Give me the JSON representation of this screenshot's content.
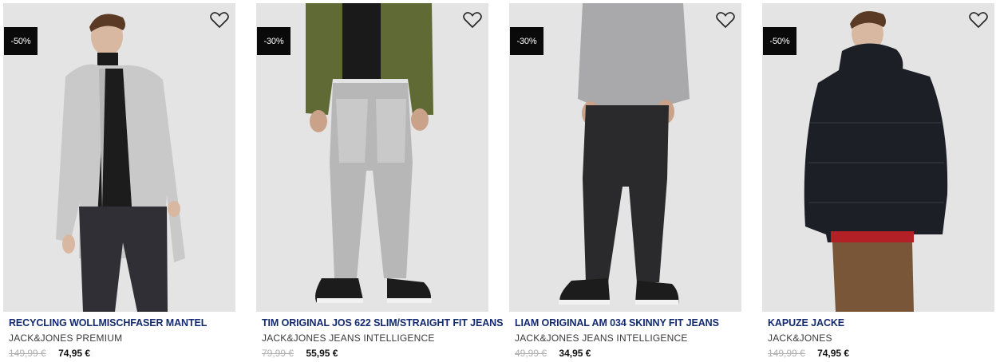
{
  "products": [
    {
      "badge": "-50%",
      "title": "RECYCLING WOLLMISCHFASER MANTEL",
      "brand": "JACK&JONES PREMIUM",
      "old_price": "149,99 €",
      "new_price": "74,95 €",
      "image_desc": "man in grey wool coat"
    },
    {
      "badge": "-30%",
      "title": "TIM ORIGINAL JOS 622 SLIM/STRAIGHT FIT JEANS",
      "brand": "JACK&JONES JEANS INTELLIGENCE",
      "old_price": "79,99 €",
      "new_price": "55,95 €",
      "image_desc": "light grey jeans with olive jacket"
    },
    {
      "badge": "-30%",
      "title": "LIAM ORIGINAL AM 034 SKINNY FIT JEANS",
      "brand": "JACK&JONES JEANS INTELLIGENCE",
      "old_price": "49,99 €",
      "new_price": "34,95 €",
      "image_desc": "black skinny jeans with grey sweatshirt"
    },
    {
      "badge": "-50%",
      "title": "KAPUZE JACKE",
      "brand": "JACK&JONES",
      "old_price": "149,99 €",
      "new_price": "74,95 €",
      "image_desc": "black hooded puffer jacket"
    }
  ],
  "icons": {
    "wishlist": "heart-outline-icon"
  },
  "colors": {
    "title": "#132a6e",
    "badge_bg": "#0a0a0a",
    "old_price": "#b0b0b0"
  }
}
